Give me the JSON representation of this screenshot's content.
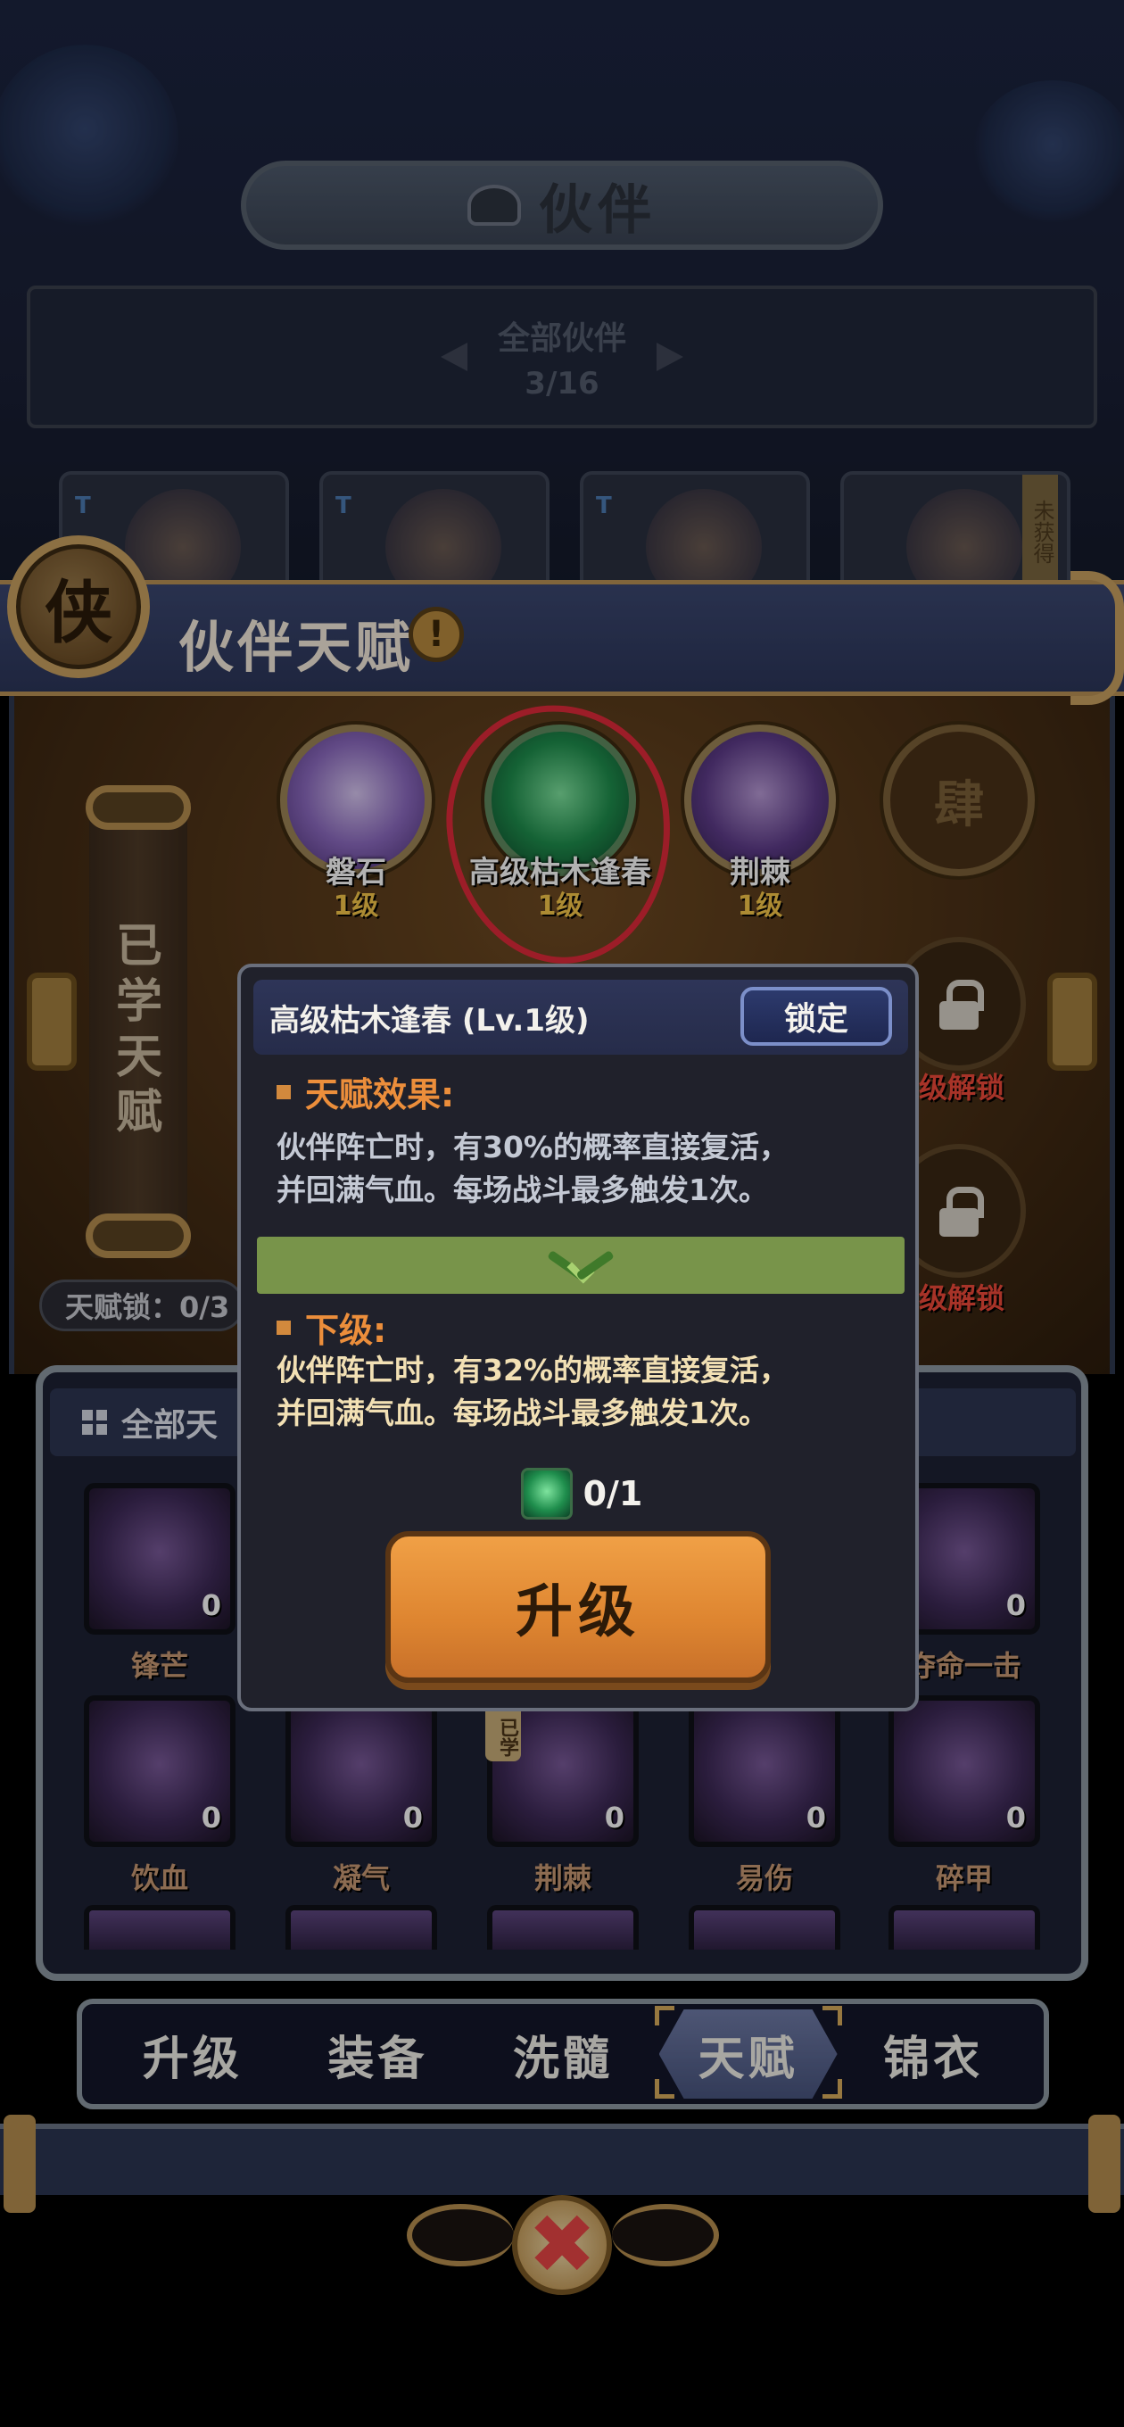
{
  "header": {
    "title": "伙伴"
  },
  "filter": {
    "title": "全部伙伴",
    "count": "3/16"
  },
  "hero_cards": [
    {
      "tag": "T"
    },
    {
      "tag": "T"
    },
    {
      "tag": "T"
    },
    {
      "tag": "",
      "status": "未获得"
    }
  ],
  "talent_panel": {
    "badge": "侠",
    "title": "伙伴天赋",
    "info_glyph": "!",
    "learned_label": "已学天赋",
    "lock_status": "天赋锁：0/3"
  },
  "talent_nodes": [
    {
      "name": "磐石",
      "level": "1级"
    },
    {
      "name": "高级枯木逢春",
      "level": "1级"
    },
    {
      "name": "荆棘",
      "level": "1级"
    },
    {
      "name": "",
      "glyph": "肆"
    }
  ],
  "locked_slots": [
    {
      "label": "级解锁"
    },
    {
      "label": "级解锁"
    }
  ],
  "all_talents": {
    "header": "全部天",
    "row1": [
      {
        "name": "锋芒",
        "count": "0"
      },
      {
        "name": "",
        "count": ""
      },
      {
        "name": "",
        "count": ""
      },
      {
        "name": "",
        "count": ""
      },
      {
        "name": "夺命一击",
        "count": "0"
      }
    ],
    "row2": [
      {
        "name": "饮血",
        "count": "0"
      },
      {
        "name": "凝气",
        "count": "0"
      },
      {
        "name": "荆棘",
        "count": "0",
        "badge": "已学"
      },
      {
        "name": "易伤",
        "count": "0"
      },
      {
        "name": "碎甲",
        "count": "0"
      }
    ]
  },
  "tabs": [
    {
      "label": "升级",
      "active": false
    },
    {
      "label": "装备",
      "active": false
    },
    {
      "label": "洗髓",
      "active": false
    },
    {
      "label": "天赋",
      "active": true
    },
    {
      "label": "锦衣",
      "active": false
    }
  ],
  "close_button": {
    "glyph": "✖"
  },
  "modal": {
    "title": "高级枯木逢春 (Lv.1级)",
    "lock_button": "锁定",
    "effect_heading": "天赋效果:",
    "effect_line1": "伙伴阵亡时，有30%的概率直接复活，",
    "effect_line2": "并回满气血。每场战斗最多触发1次。",
    "next_heading": "下级:",
    "next_line1": "伙伴阵亡时，有32%的概率直接复活，",
    "next_line2": "并回满气血。每场战斗最多触发1次。",
    "cost": "0/1",
    "upgrade_button": "升级"
  },
  "colors": {
    "accent_orange": "#ec8e3b",
    "level_gold": "#f6c84a",
    "unlock_red": "#f04a3a",
    "upgrade_button": "#de8530",
    "annotation_red": "#e02a3a"
  },
  "icons": {
    "info": "info-icon",
    "lock": "lock-icon",
    "chevron": "chevron-down-icon",
    "close": "close-icon",
    "grid": "grid-icon"
  }
}
